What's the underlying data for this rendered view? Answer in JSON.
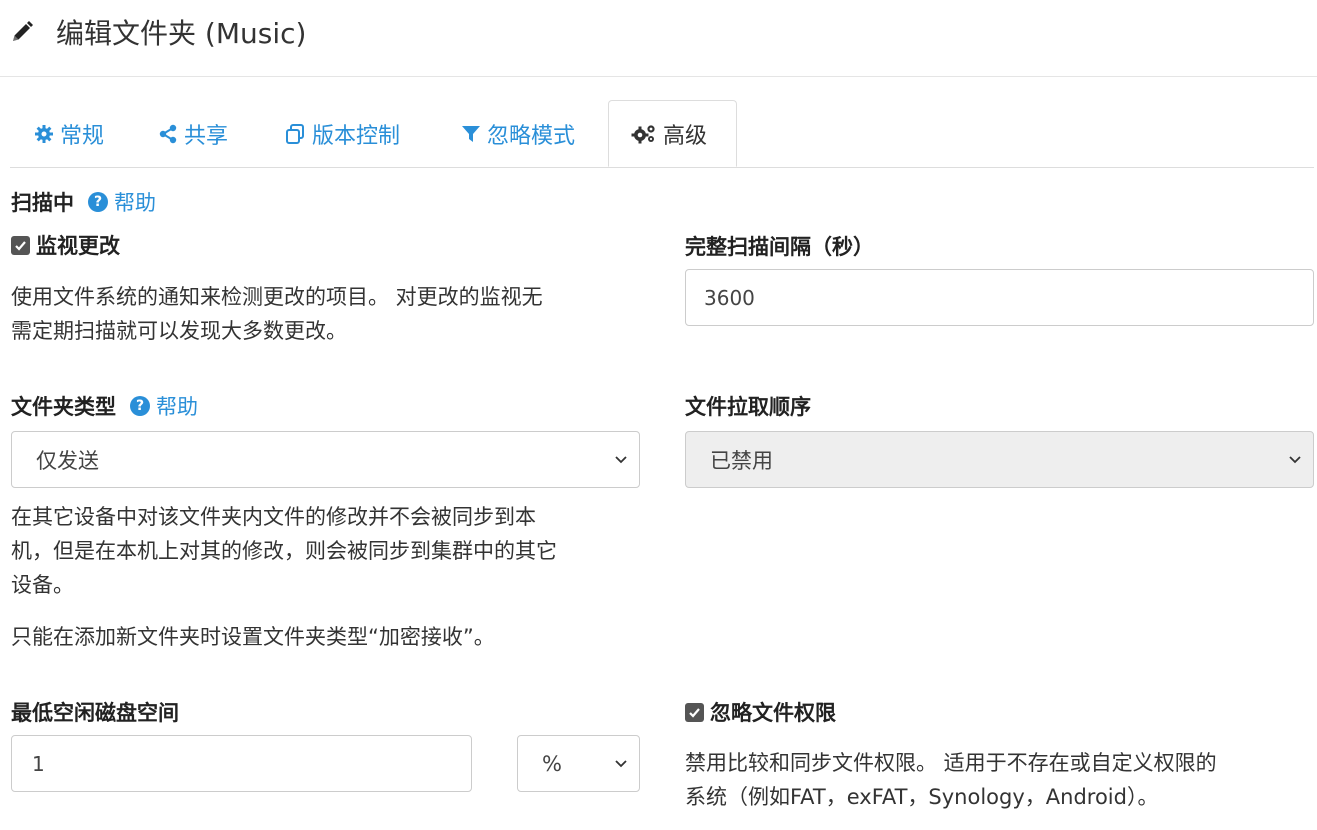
{
  "header": {
    "title": "编辑文件夹 (Music)",
    "icon": "pencil-icon"
  },
  "tabs": [
    {
      "label": "常规",
      "icon": "gear-icon"
    },
    {
      "label": "共享",
      "icon": "share-icon"
    },
    {
      "label": "版本控制",
      "icon": "copy-icon"
    },
    {
      "label": "忽略模式",
      "icon": "filter-icon"
    },
    {
      "label": "高级",
      "icon": "gears-icon",
      "active": true
    }
  ],
  "scanning": {
    "title": "扫描中",
    "help": "帮助"
  },
  "watch": {
    "label": "监视更改",
    "checked": true,
    "description_line1": "使用文件系统的通知来检测更改的项目。 对更改的监视无",
    "description_line2": "需定期扫描就可以发现大多数更改。"
  },
  "full_scan": {
    "label": "完整扫描间隔（秒）",
    "value": "3600"
  },
  "folder_type": {
    "label": "文件夹类型",
    "help": "帮助",
    "selected": "仅发送",
    "description_line1": "在其它设备中对该文件夹内文件的修改并不会被同步到本",
    "description_line2": "机，但是在本机上对其的修改，则会被同步到集群中的其它",
    "description_line3": "设备。",
    "note": "只能在添加新文件夹时设置文件夹类型“加密接收”。"
  },
  "pull_order": {
    "label": "文件拉取顺序",
    "selected": "已禁用",
    "disabled": true
  },
  "min_disk": {
    "label": "最低空闲磁盘空间",
    "value": "1",
    "unit": "%"
  },
  "ignore_perms": {
    "label": "忽略文件权限",
    "checked": true,
    "description_line1": "禁用比较和同步文件权限。 适用于不存在或自定义权限的",
    "description_line2": "系统（例如FAT，exFAT，Synology，Android）。"
  },
  "colors": {
    "link": "#2a8fd8",
    "text": "#333333",
    "border": "#cccccc",
    "disabled_bg": "#eeeeee"
  }
}
